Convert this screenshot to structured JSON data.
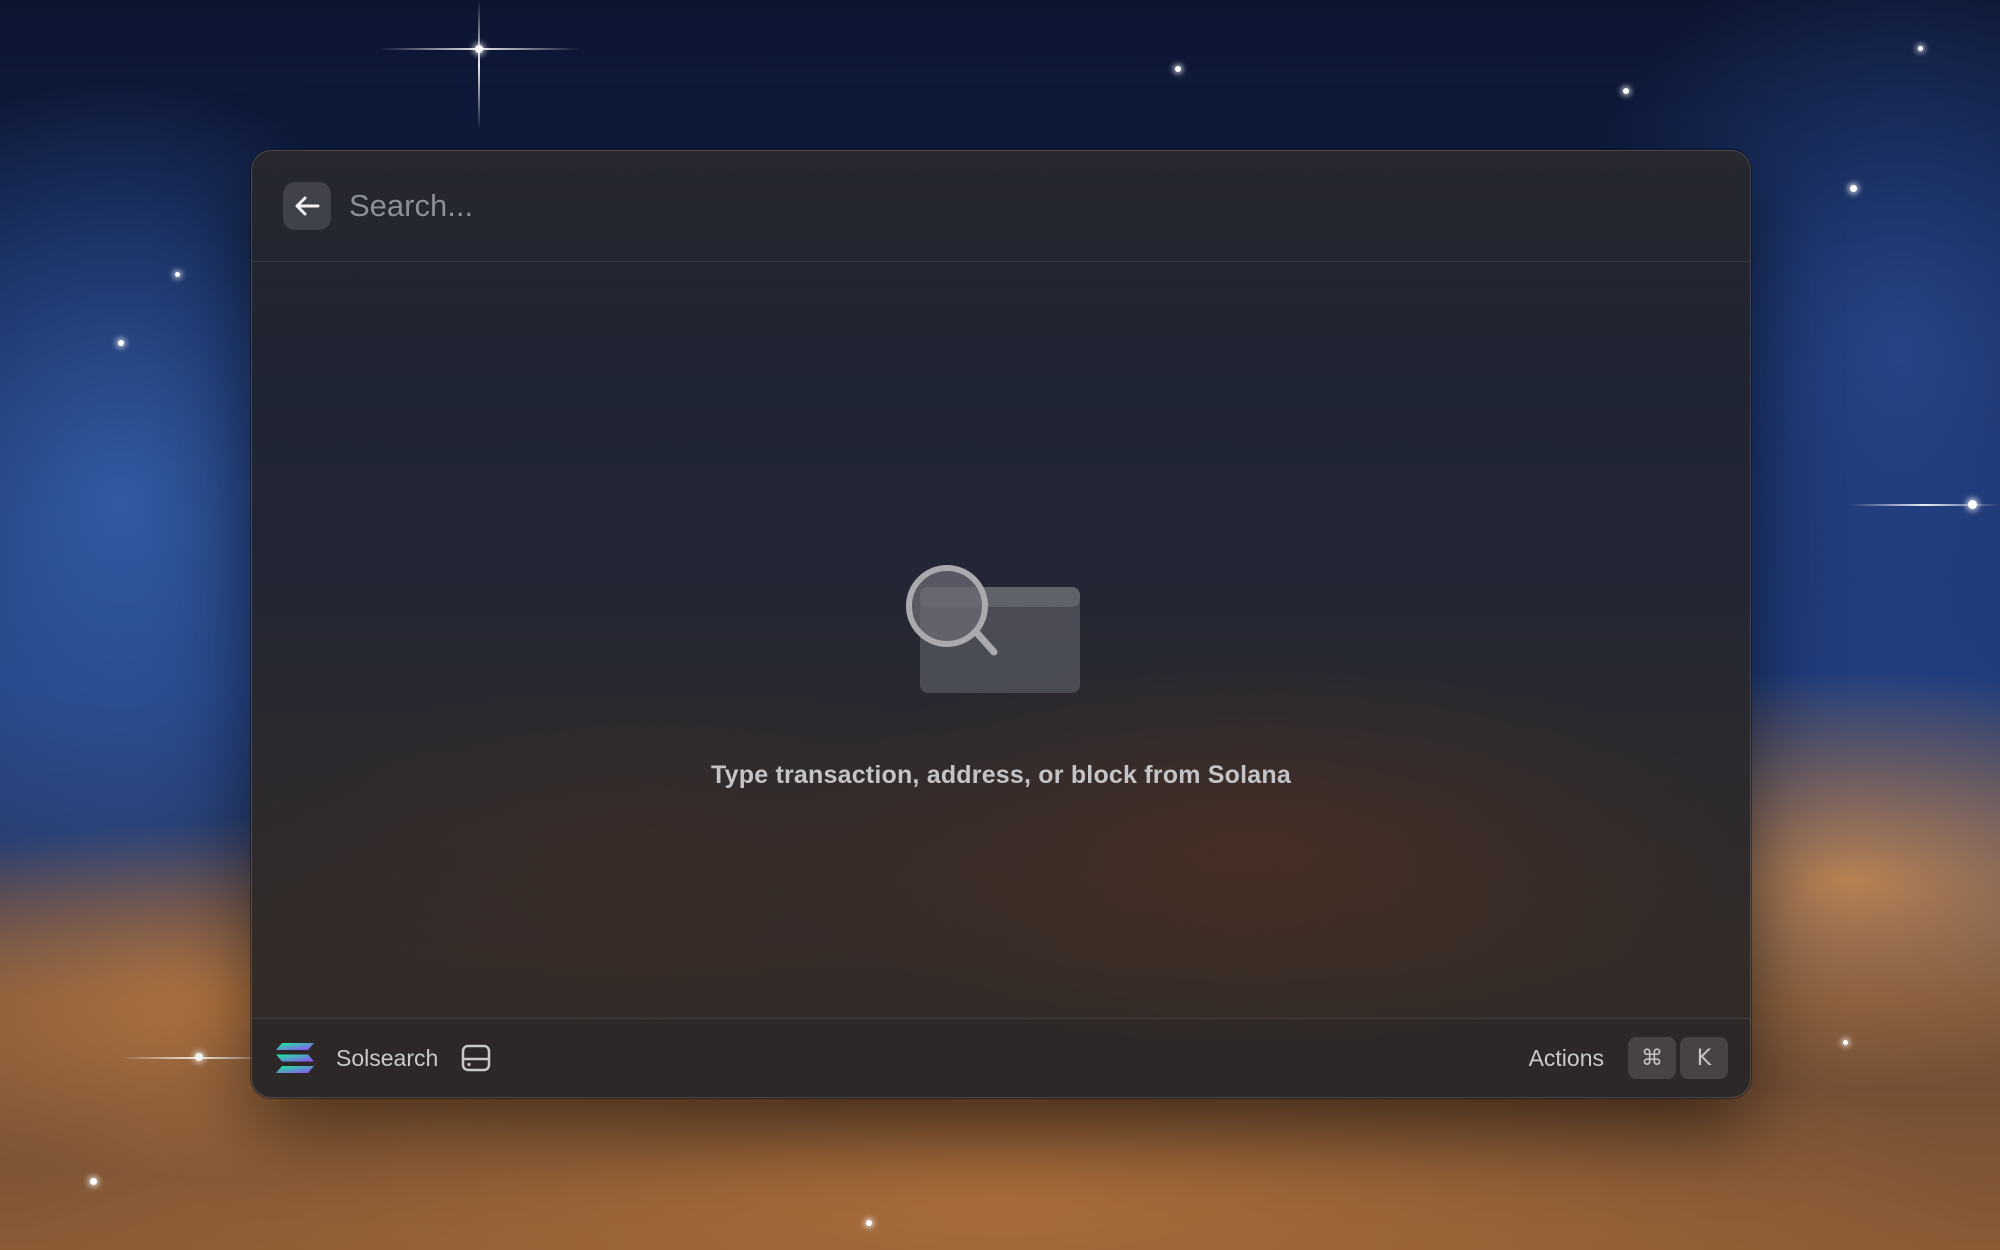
{
  "search": {
    "placeholder": "Search...",
    "value": ""
  },
  "empty_state": {
    "icon": "magnifier-over-window-icon",
    "message": "Type transaction, address, or block from Solana"
  },
  "footer": {
    "brand_icon": "solana-logo-icon",
    "brand_name": "Solsearch",
    "secondary_icon": "storage-drive-icon",
    "actions_label": "Actions",
    "shortcut_keys": [
      "⌘",
      "K"
    ]
  },
  "colors": {
    "window_border": "#4a4a52",
    "text_primary": "#c9c9cc",
    "placeholder": "#8d8f96",
    "solana_gradient": [
      "#14f195",
      "#9945ff"
    ]
  }
}
